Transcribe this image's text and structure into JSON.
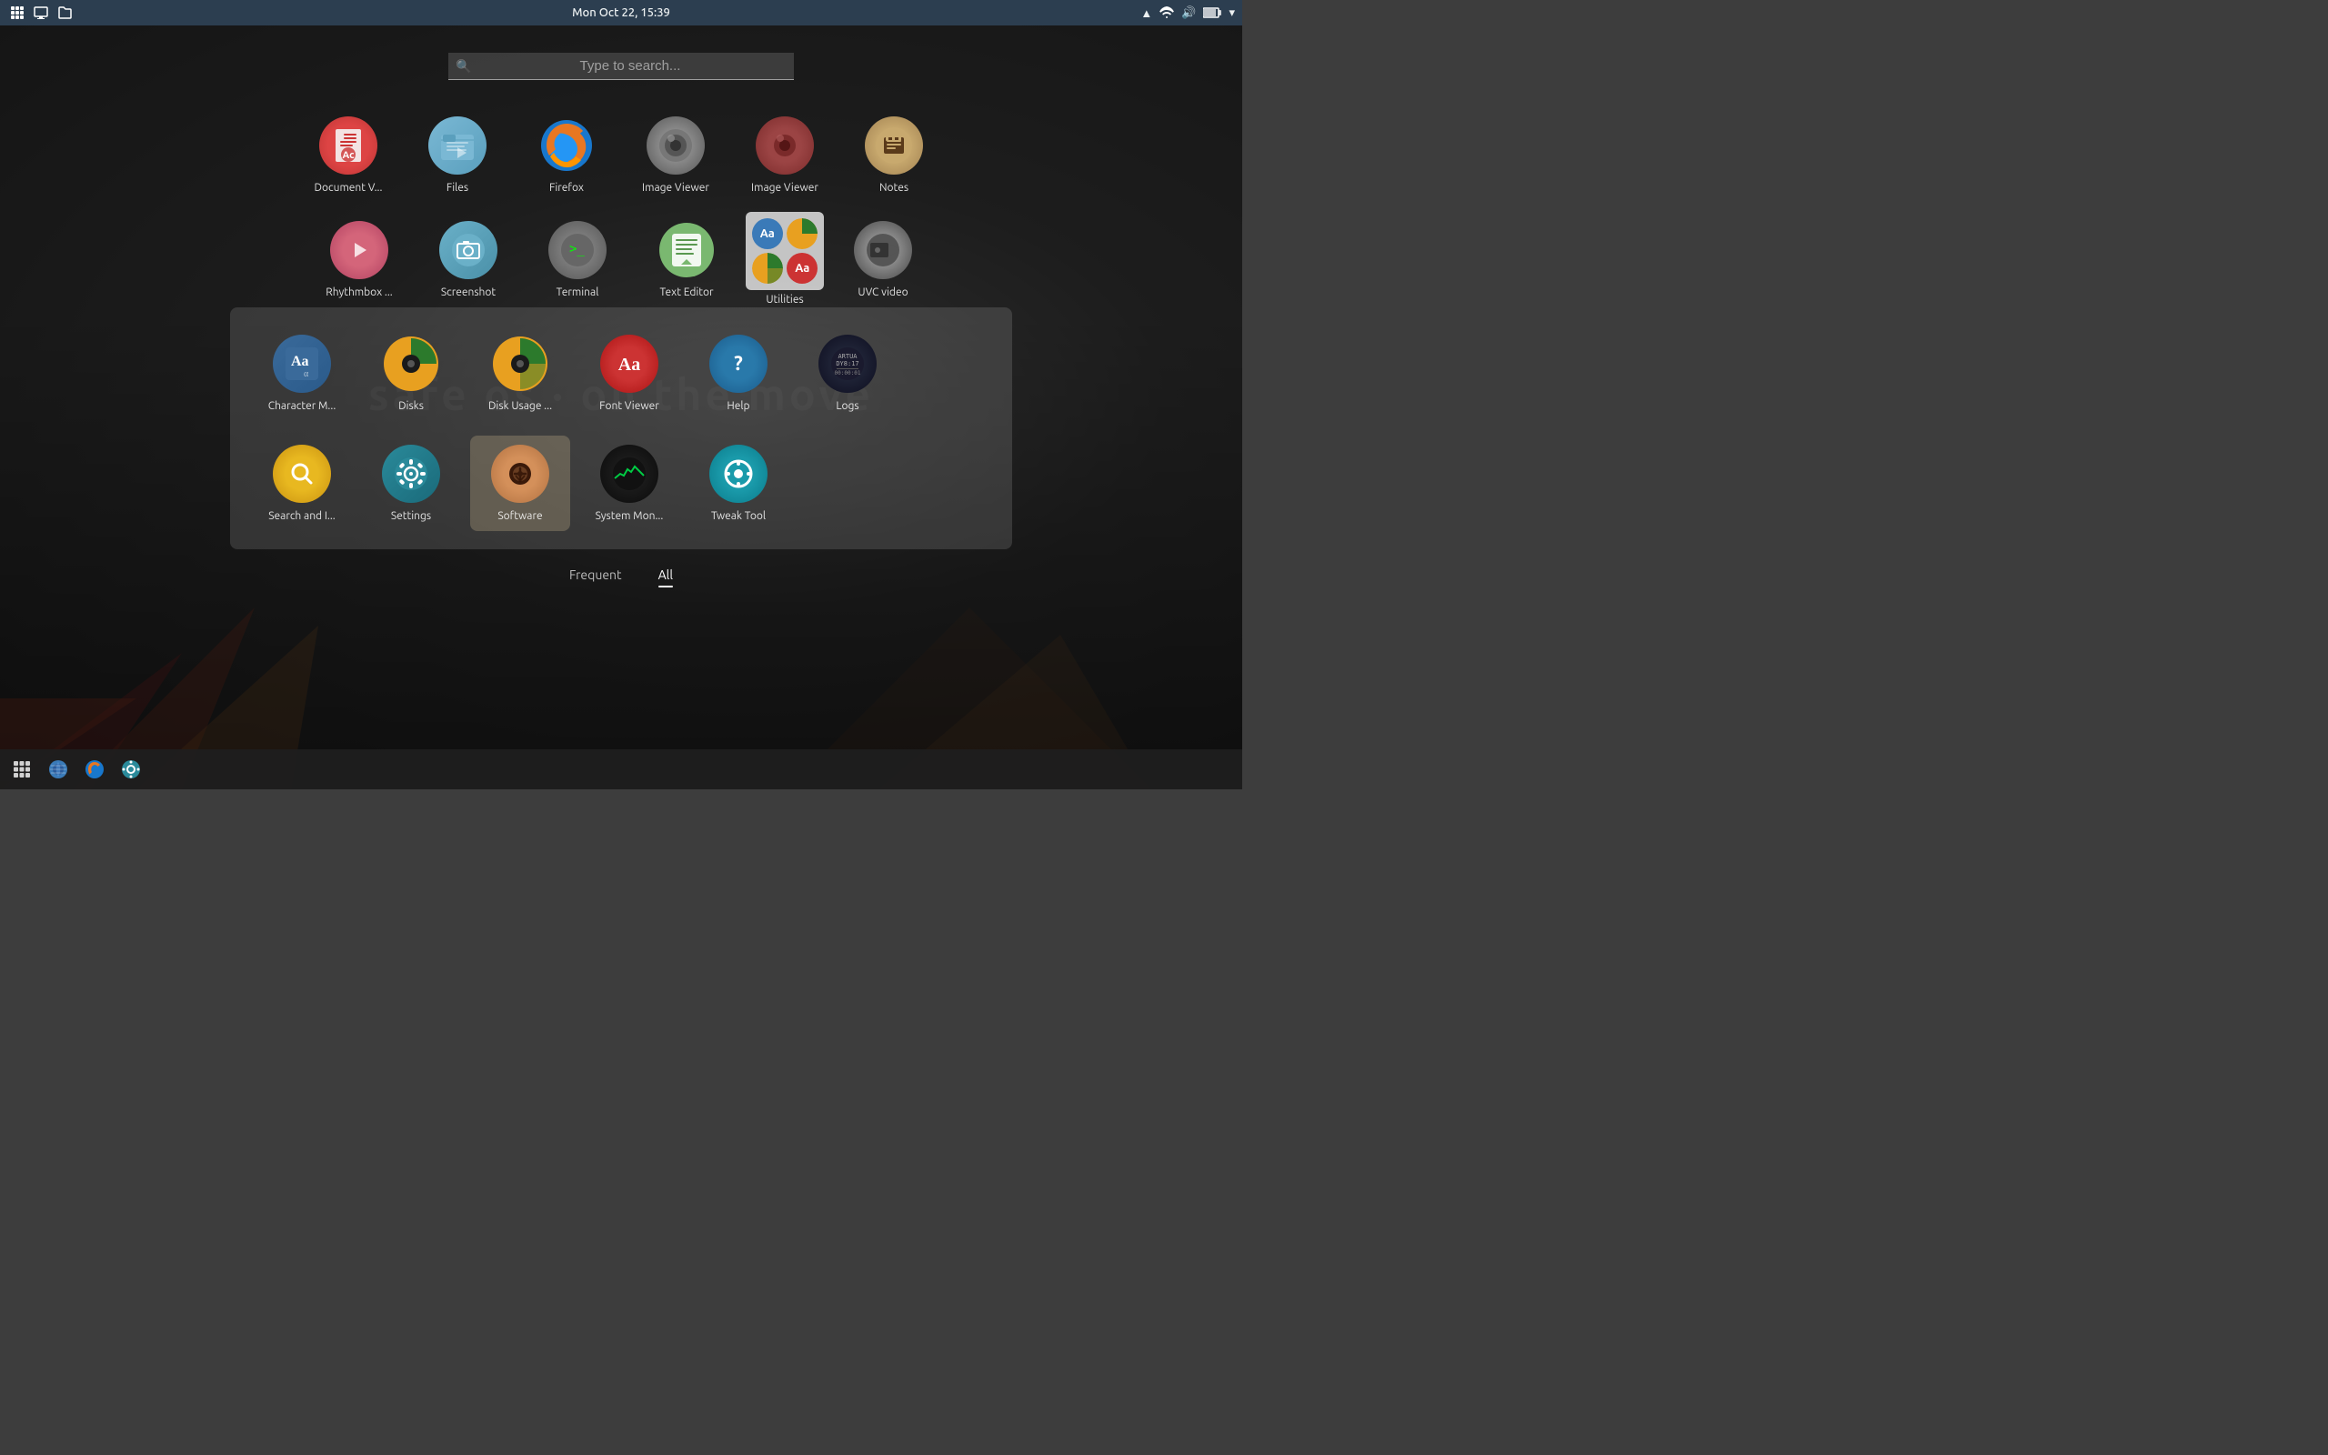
{
  "topPanel": {
    "datetime": "Mon Oct 22, 15:39",
    "leftIcons": [
      "apps-icon",
      "files-icon",
      "filemanager-icon"
    ]
  },
  "searchBar": {
    "placeholder": "Type to search..."
  },
  "topApps": [
    {
      "id": "document-viewer",
      "label": "Document V...",
      "iconType": "document-viewer"
    },
    {
      "id": "files",
      "label": "Files",
      "iconType": "files"
    },
    {
      "id": "firefox",
      "label": "Firefox",
      "iconType": "firefox"
    },
    {
      "id": "image-viewer1",
      "label": "Image Viewer",
      "iconType": "image-viewer"
    },
    {
      "id": "image-viewer2",
      "label": "Image Viewer",
      "iconType": "image-viewer2"
    },
    {
      "id": "notes",
      "label": "Notes",
      "iconType": "notes"
    }
  ],
  "middleAppsLeft": [
    {
      "id": "rhythmbox",
      "label": "Rhythmbox ...",
      "iconType": "rhythmbox"
    },
    {
      "id": "screenshot",
      "label": "Screenshot",
      "iconType": "screenshot"
    },
    {
      "id": "terminal",
      "label": "Terminal",
      "iconType": "terminal"
    },
    {
      "id": "text-editor",
      "label": "Text Editor",
      "iconType": "text-editor"
    }
  ],
  "utilitiesPopup": {
    "label": "Utilities"
  },
  "uvcApp": {
    "id": "uvc-video",
    "label": "UVC video",
    "iconType": "uvc"
  },
  "utilitiesRow1": [
    {
      "id": "char-map",
      "label": "Character M...",
      "iconType": "char-map"
    },
    {
      "id": "disks",
      "label": "Disks",
      "iconType": "disks"
    },
    {
      "id": "disk-usage",
      "label": "Disk Usage ...",
      "iconType": "disk-usage"
    },
    {
      "id": "font-viewer",
      "label": "Font Viewer",
      "iconType": "font-viewer"
    },
    {
      "id": "help",
      "label": "Help",
      "iconType": "help"
    },
    {
      "id": "logs",
      "label": "Logs",
      "iconType": "logs"
    }
  ],
  "utilitiesRow2": [
    {
      "id": "search-install",
      "label": "Search and I...",
      "iconType": "search-install"
    },
    {
      "id": "settings",
      "label": "Settings",
      "iconType": "settings"
    },
    {
      "id": "software",
      "label": "Software",
      "iconType": "software"
    },
    {
      "id": "system-monitor",
      "label": "System Mon...",
      "iconType": "system-monitor"
    },
    {
      "id": "tweak-tool",
      "label": "Tweak Tool",
      "iconType": "tweak"
    }
  ],
  "tabs": [
    {
      "id": "frequent",
      "label": "Frequent"
    },
    {
      "id": "all",
      "label": "All",
      "active": true
    }
  ],
  "taskbar": [
    {
      "id": "show-desktop",
      "label": "⊞"
    },
    {
      "id": "browser1",
      "label": "🌐"
    },
    {
      "id": "firefox-task",
      "label": "🦊"
    },
    {
      "id": "settings-task",
      "label": "⚙"
    }
  ],
  "watermark": "safe OS · on the move"
}
